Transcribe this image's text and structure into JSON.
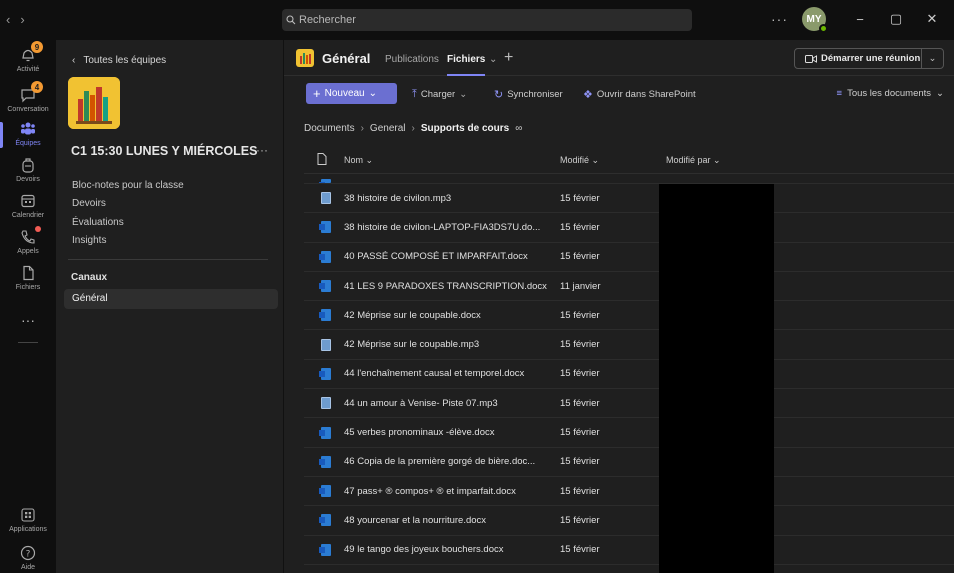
{
  "titlebar": {
    "search_placeholder": "Rechercher",
    "more": "···",
    "avatar_initials": "MY",
    "minimize": "−",
    "maximize": "▢",
    "close": "✕"
  },
  "rail": {
    "items": [
      {
        "label": "Activité",
        "badge": "9"
      },
      {
        "label": "Conversation",
        "badge": "4"
      },
      {
        "label": "Équipes"
      },
      {
        "label": "Devoirs"
      },
      {
        "label": "Calendrier"
      },
      {
        "label": "Appels"
      },
      {
        "label": "Fichiers"
      },
      {
        "label": "···"
      },
      {
        "label": "Applications"
      },
      {
        "label": "Aide"
      }
    ]
  },
  "team": {
    "back_label": "Toutes les équipes",
    "name": "C1 15:30 LUNES Y MIÉRCOLES",
    "more": "···",
    "links": [
      "Bloc-notes pour la classe",
      "Devoirs",
      "Évaluations",
      "Insights"
    ],
    "channels_header": "Canaux",
    "active_channel": "Général"
  },
  "channel": {
    "title": "Général",
    "tabs": [
      "Publications",
      "Fichiers"
    ],
    "plus": "+",
    "meet_label": "Démarrer une réunion"
  },
  "toolbar": {
    "new_label": "Nouveau",
    "upload_label": "Charger",
    "sync_label": "Synchroniser",
    "sharepoint_label": "Ouvrir dans SharePoint",
    "all_docs_label": "Tous les documents"
  },
  "breadcrumb": [
    "Documents",
    "General",
    "Supports de cours"
  ],
  "table": {
    "headers": {
      "name": "Nom",
      "modified": "Modifié",
      "modified_by": "Modifié par"
    },
    "rows": [
      {
        "type": "mp3",
        "name": "38 histoire de civilon.mp3",
        "modified": "15 février"
      },
      {
        "type": "docx",
        "name": "38 histoire de civilon-LAPTOP-FIA3DS7U.do...",
        "modified": "15 février"
      },
      {
        "type": "docx",
        "name": "40 PASSÉ COMPOSÉ ET IMPARFAIT.docx",
        "modified": "15 février"
      },
      {
        "type": "docx",
        "name": "41 LES 9 PARADOXES TRANSCRIPTION.docx",
        "modified": "11 janvier"
      },
      {
        "type": "docx",
        "name": "42 Méprise sur le coupable.docx",
        "modified": "15 février"
      },
      {
        "type": "mp3",
        "name": "42 Méprise sur le coupable.mp3",
        "modified": "15 février"
      },
      {
        "type": "docx",
        "name": "44 l'enchaînement causal et temporel.docx",
        "modified": "15 février"
      },
      {
        "type": "mp3",
        "name": "44 un amour à Venise- Piste 07.mp3",
        "modified": "15 février"
      },
      {
        "type": "docx",
        "name": "45 verbes pronominaux -élève.docx",
        "modified": "15 février"
      },
      {
        "type": "docx",
        "name": "46 Copia de la première gorgé de bière.doc...",
        "modified": "15 février"
      },
      {
        "type": "docx",
        "name": "47 pass+ ® compos+ ® et imparfait.docx",
        "modified": "15 février"
      },
      {
        "type": "docx",
        "name": "48 yourcenar et la nourriture.docx",
        "modified": "15 février"
      },
      {
        "type": "docx",
        "name": "49 le tango des joyeux bouchers.docx",
        "modified": "15 février"
      }
    ]
  },
  "colors": {
    "accent": "#7f85f5",
    "new_button": "#6b6fd1",
    "team_logo": "#f1c232",
    "badge": "#f49a32"
  }
}
